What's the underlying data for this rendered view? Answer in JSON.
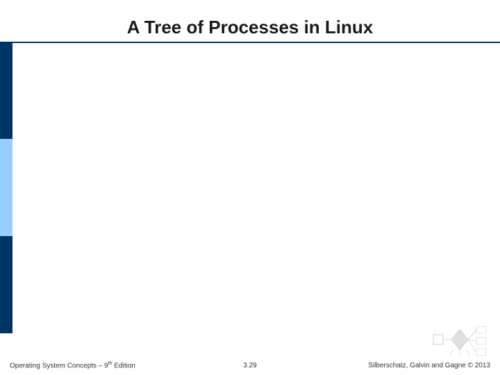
{
  "slide": {
    "title": "A Tree of Processes in Linux"
  },
  "footer": {
    "left_prefix": "Operating System Concepts – 9",
    "left_super": "th",
    "left_suffix": " Edition",
    "center": "3.29",
    "right": "Silberschatz, Galvin and Gagne © 2013"
  }
}
